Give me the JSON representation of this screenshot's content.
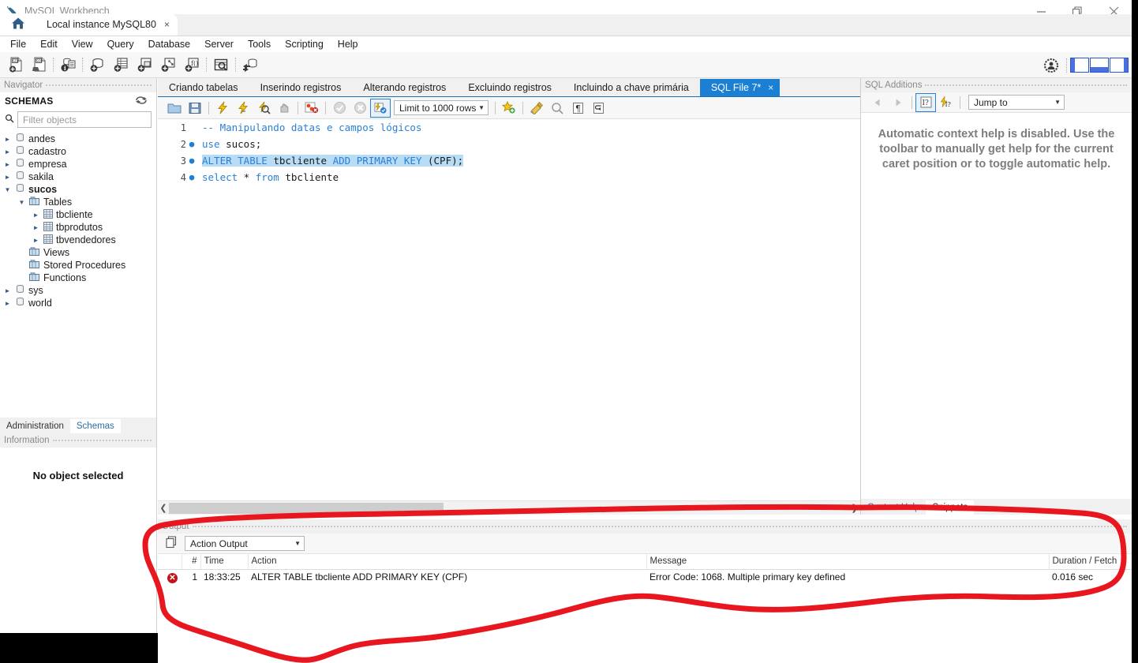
{
  "window": {
    "title": "MySQL Workbench",
    "app_icon": "workbench-dolphin-icon",
    "controls": {
      "minimize": "minimize-icon",
      "maximize": "restore-icon",
      "close": "close-icon"
    }
  },
  "connection_tabs": {
    "home_icon": "home-icon",
    "tabs": [
      {
        "label": "Local instance MySQL80",
        "close": "×",
        "active": true
      }
    ]
  },
  "menubar": {
    "items": [
      "File",
      "Edit",
      "View",
      "Query",
      "Database",
      "Server",
      "Tools",
      "Scripting",
      "Help"
    ]
  },
  "main_toolbar": {
    "buttons": [
      "new-sql-tab-icon",
      "open-sql-script-icon",
      "connection-info-icon",
      "create-schema-icon",
      "create-table-icon",
      "create-view-icon",
      "create-procedure-icon",
      "create-function-icon",
      "search-data-icon",
      "reconnect-server-icon"
    ],
    "right_buttons": [
      "account-icon",
      "toggle-sidebar-icon",
      "toggle-output-icon",
      "toggle-secondary-sidebar-icon"
    ]
  },
  "navigator": {
    "caption": "Navigator",
    "section_title": "SCHEMAS",
    "refresh_icon": "refresh-icon",
    "search_icon": "search-icon",
    "filter_placeholder": "Filter objects",
    "tree": [
      {
        "label": "andes",
        "icon": "schema-icon",
        "level": 1,
        "state": "collapsed"
      },
      {
        "label": "cadastro",
        "icon": "schema-icon",
        "level": 1,
        "state": "collapsed"
      },
      {
        "label": "empresa",
        "icon": "schema-icon",
        "level": 1,
        "state": "collapsed"
      },
      {
        "label": "sakila",
        "icon": "schema-icon",
        "level": 1,
        "state": "collapsed"
      },
      {
        "label": "sucos",
        "icon": "schema-icon",
        "level": 1,
        "state": "expanded",
        "bold": true
      },
      {
        "label": "Tables",
        "icon": "folder-icon",
        "level": 2,
        "state": "expanded"
      },
      {
        "label": "tbcliente",
        "icon": "table-icon",
        "level": 3,
        "state": "collapsed"
      },
      {
        "label": "tbprodutos",
        "icon": "table-icon",
        "level": 3,
        "state": "collapsed"
      },
      {
        "label": "tbvendedores",
        "icon": "table-icon",
        "level": 3,
        "state": "collapsed"
      },
      {
        "label": "Views",
        "icon": "folder-icon",
        "level": 2,
        "state": "none"
      },
      {
        "label": "Stored Procedures",
        "icon": "folder-icon",
        "level": 2,
        "state": "none"
      },
      {
        "label": "Functions",
        "icon": "folder-icon",
        "level": 2,
        "state": "none"
      },
      {
        "label": "sys",
        "icon": "schema-icon",
        "level": 1,
        "state": "collapsed"
      },
      {
        "label": "world",
        "icon": "schema-icon",
        "level": 1,
        "state": "collapsed"
      }
    ],
    "bottom_tabs": [
      {
        "label": "Administration",
        "active": false
      },
      {
        "label": "Schemas",
        "active": true
      }
    ],
    "information": {
      "caption": "Information",
      "empty_text": "No object selected"
    }
  },
  "editor": {
    "tabs": [
      {
        "label": "Criando tabelas",
        "active": false
      },
      {
        "label": "Inserindo registros",
        "active": false
      },
      {
        "label": "Alterando registros",
        "active": false
      },
      {
        "label": "Excluindo registros",
        "active": false
      },
      {
        "label": "Incluindo a chave primária",
        "active": false
      },
      {
        "label": "SQL File 7*",
        "active": true,
        "close": "×"
      }
    ],
    "toolbar": {
      "buttons": [
        "open-file-icon",
        "save-file-icon",
        "execute-icon",
        "execute-current-statement-icon",
        "explain-icon",
        "stop-icon",
        "toggle-stop-on-error-icon",
        "commit-icon",
        "rollback-icon",
        "autocommit-icon"
      ],
      "limit_label": "Limit to 1000 rows",
      "right_buttons": [
        "new-snippet-icon",
        "beautify-sql-icon",
        "find-icon",
        "toggle-invisible-chars-icon",
        "wrap-lines-icon"
      ]
    },
    "lines": [
      {
        "number": "1",
        "marker": "",
        "segments": [
          {
            "text": "-- Manipulando datas e campos lógicos",
            "style": "cmt"
          }
        ]
      },
      {
        "number": "2",
        "marker": "●",
        "segments": [
          {
            "text": "use",
            "style": "kw"
          },
          {
            "text": " sucos;",
            "style": ""
          }
        ]
      },
      {
        "number": "3",
        "marker": "●",
        "selected": true,
        "segments": [
          {
            "text": "ALTER TABLE",
            "style": "kw"
          },
          {
            "text": " tbcliente ",
            "style": ""
          },
          {
            "text": "ADD PRIMARY KEY",
            "style": "kw"
          },
          {
            "text": " (CPF);",
            "style": ""
          }
        ]
      },
      {
        "number": "4",
        "marker": "●",
        "segments": [
          {
            "text": "select",
            "style": "kw"
          },
          {
            "text": " * ",
            "style": ""
          },
          {
            "text": "from",
            "style": "kw"
          },
          {
            "text": " tbcliente",
            "style": ""
          }
        ]
      }
    ]
  },
  "sql_additions": {
    "caption": "SQL Additions",
    "toolbar": {
      "back_icon": "arrow-left-icon",
      "forward_icon": "arrow-right-icon",
      "manual_help_icon": "context-help-icon",
      "auto_help_icon": "automatic-help-icon",
      "jump_to_label": "Jump to"
    },
    "message": "Automatic context help is disabled. Use the toolbar to manually get help for the current caret position or to toggle automatic help.",
    "bottom_tabs": [
      {
        "label": "Context Help",
        "active": false
      },
      {
        "label": "Snippets",
        "active": true
      }
    ]
  },
  "output": {
    "caption": "Output",
    "view_icon": "output-view-icon",
    "selected_view": "Action Output",
    "columns": [
      "#",
      "Time",
      "Action",
      "Message",
      "Duration / Fetch"
    ],
    "rows": [
      {
        "status": "error",
        "status_glyph": "✕",
        "num": "1",
        "time": "18:33:25",
        "action": "ALTER TABLE tbcliente ADD PRIMARY KEY (CPF)",
        "message": "Error Code: 1068. Multiple primary key defined",
        "duration": "0.016 sec"
      }
    ]
  },
  "annotation": {
    "type": "freehand-lasso",
    "color": "#e8171f",
    "description": "Hand-drawn red circle around the Output action-output panel"
  }
}
